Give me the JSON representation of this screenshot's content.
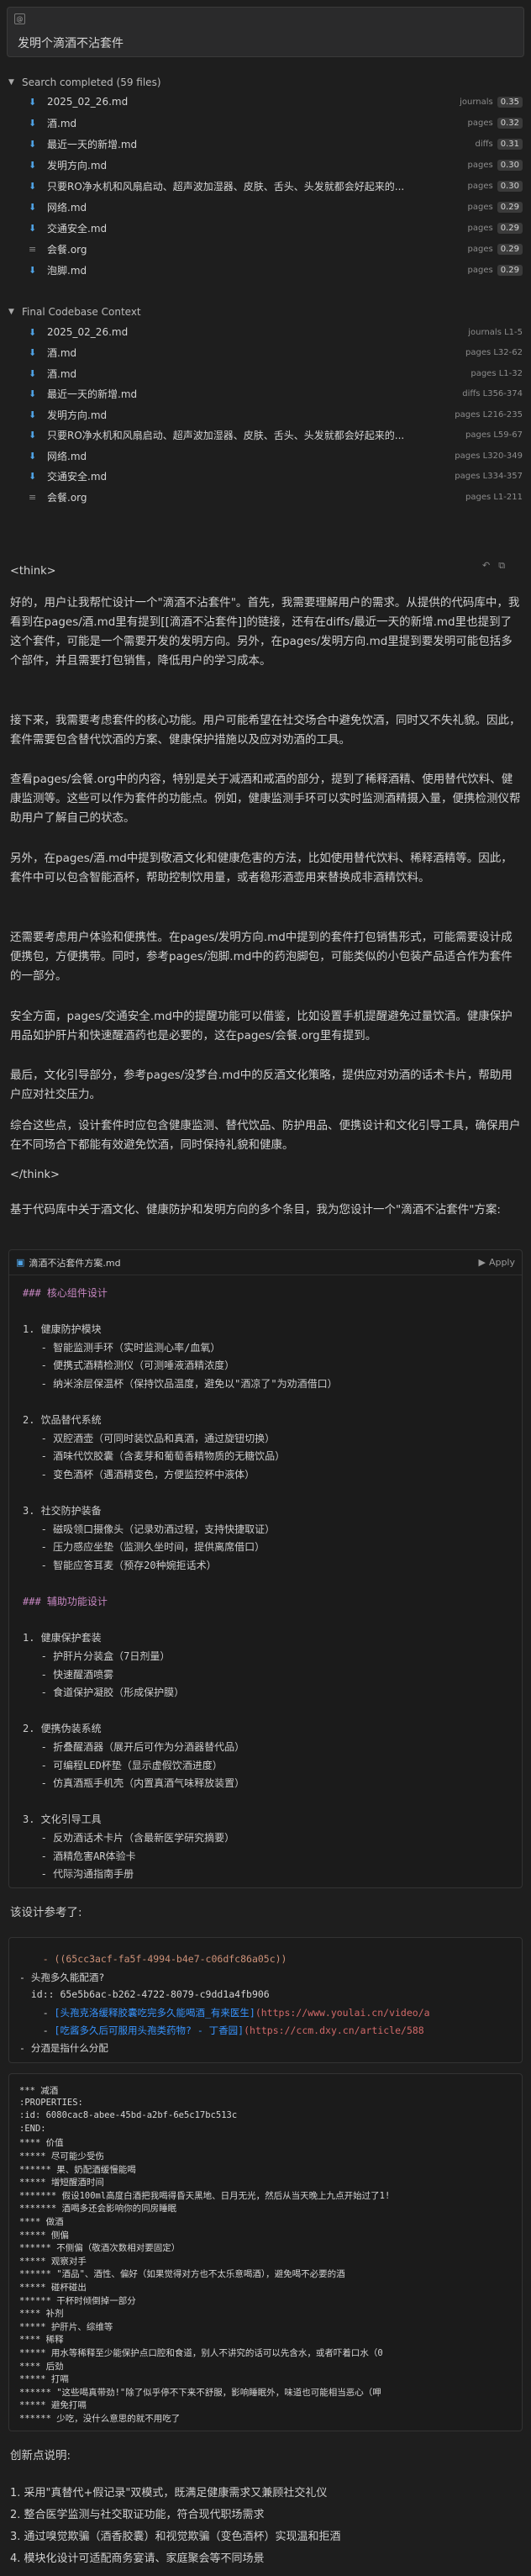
{
  "prompt": {
    "tag_icon": "at-icon",
    "text": "发明个滴酒不沾套件"
  },
  "search": {
    "header": "Search completed (59 files)",
    "rows": [
      {
        "name": "2025_02_26.md",
        "path": "journals",
        "score": "0.35",
        "icon": "download-icon"
      },
      {
        "name": "酒.md",
        "path": "pages",
        "score": "0.32",
        "icon": "download-icon"
      },
      {
        "name": "最近一天的新增.md",
        "path": "diffs",
        "score": "0.31",
        "icon": "download-icon"
      },
      {
        "name": "发明方向.md",
        "path": "pages",
        "score": "0.30",
        "icon": "download-icon"
      },
      {
        "name": "只要RO净水机和风扇启动、超声波加湿器、皮肤、舌头、头发就都会好起来的...",
        "path": "pages",
        "score": "0.30",
        "icon": "download-icon"
      },
      {
        "name": "网络.md",
        "path": "pages",
        "score": "0.29",
        "icon": "download-icon"
      },
      {
        "name": "交通安全.md",
        "path": "pages",
        "score": "0.29",
        "icon": "download-icon"
      },
      {
        "name": "会餐.org",
        "path": "pages",
        "score": "0.29",
        "icon": "org-icon"
      },
      {
        "name": "泡脚.md",
        "path": "pages",
        "score": "0.29",
        "icon": "download-icon"
      }
    ]
  },
  "context": {
    "header": "Final Codebase Context",
    "rows": [
      {
        "name": "2025_02_26.md",
        "path": "journals L1-5",
        "icon": "download-icon"
      },
      {
        "name": "酒.md",
        "path": "pages L32-62",
        "icon": "download-icon"
      },
      {
        "name": "酒.md",
        "path": "pages L1-32",
        "icon": "download-icon"
      },
      {
        "name": "最近一天的新增.md",
        "path": "diffs L356-374",
        "icon": "download-icon"
      },
      {
        "name": "发明方向.md",
        "path": "pages L216-235",
        "icon": "download-icon"
      },
      {
        "name": "只要RO净水机和风扇启动、超声波加湿器、皮肤、舌头、头发就都会好起来的...",
        "path": "pages L59-67",
        "icon": "download-icon"
      },
      {
        "name": "网络.md",
        "path": "pages L320-349",
        "icon": "download-icon"
      },
      {
        "name": "交通安全.md",
        "path": "pages L334-357",
        "icon": "download-icon"
      },
      {
        "name": "会餐.org",
        "path": "pages L1-211",
        "icon": "org-icon"
      }
    ]
  },
  "think_open": "<think>",
  "think_close": "</think>",
  "think_paragraphs": [
    "好的，用户让我帮忙设计一个\"滴酒不沾套件\"。首先，我需要理解用户的需求。从提供的代码库中，我看到在pages/酒.md里有提到[[滴酒不沾套件]]的链接，还有在diffs/最近一天的新增.md里也提到了这个套件，可能是一个需要开发的发明方向。另外，在pages/发明方向.md里提到要发明可能包括多个部件，并且需要打包销售，降低用户的学习成本。",
    "接下来，我需要考虑套件的核心功能。用户可能希望在社交场合中避免饮酒，同时又不失礼貌。因此，套件需要包含替代饮酒的方案、健康保护措施以及应对劝酒的工具。",
    "查看pages/会餐.org中的内容，特别是关于减酒和戒酒的部分，提到了稀释酒精、使用替代饮料、健康监测等。这些可以作为套件的功能点。例如，健康监测手环可以实时监测酒精摄入量，便携检测仪帮助用户了解自己的状态。",
    "另外，在pages/酒.md中提到敬酒文化和健康危害的方法，比如使用替代饮料、稀释酒精等。因此，套件中可以包含智能酒杯，帮助控制饮用量，或者稳形酒壶用来替换成非酒精饮料。",
    "还需要考虑用户体验和便携性。在pages/发明方向.md中提到的套件打包销售形式，可能需要设计成便携包，方便携带。同时，参考pages/泡脚.md中的药泡脚包，可能类似的小包装产品适合作为套件的一部分。",
    "安全方面，pages/交通安全.md中的提醒功能可以借鉴，比如设置手机提醒避免过量饮酒。健康保护用品如护肝片和快速醒酒药也是必要的，这在pages/会餐.org里有提到。",
    "最后，文化引导部分，参考pages/没梦台.md中的反酒文化策略，提供应对劝酒的话术卡片，帮助用户应对社交压力。",
    "综合这些点，设计套件时应包含健康监测、替代饮品、防护用品、便携设计和文化引导工具，确保用户在不同场合下都能有效避免饮酒，同时保持礼貌和健康。"
  ],
  "summary": "基于代码库中关于酒文化、健康防护和发明方向的多个条目，我为您设计一个\"滴酒不沾套件\"方案:",
  "code_card": {
    "file_name": "滴酒不沾套件方案.md",
    "apply_label": "Apply",
    "lines": [
      {
        "text": "### 核心组件设计",
        "kind": "head"
      },
      {
        "text": "",
        "kind": "plain"
      },
      {
        "text": "1. 健康防护模块",
        "kind": "plain"
      },
      {
        "text": "   - 智能监测手环（实时监测心率/血氧）",
        "kind": "plain"
      },
      {
        "text": "   - 便携式酒精检测仪（可测唾液酒精浓度）",
        "kind": "plain"
      },
      {
        "text": "   - 纳米涂层保温杯（保持饮品温度，避免以\"酒凉了\"为劝酒借口）",
        "kind": "plain"
      },
      {
        "text": "",
        "kind": "plain"
      },
      {
        "text": "2. 饮品替代系统",
        "kind": "plain"
      },
      {
        "text": "   - 双腔酒壶（可同时装饮品和真酒，通过旋钮切换）",
        "kind": "plain"
      },
      {
        "text": "   - 酒味代饮胶囊（含麦芽和葡萄香精物质的无糖饮品）",
        "kind": "plain"
      },
      {
        "text": "   - 变色酒杯（遇酒精变色，方便监控杯中液体）",
        "kind": "plain"
      },
      {
        "text": "",
        "kind": "plain"
      },
      {
        "text": "3. 社交防护装备",
        "kind": "plain"
      },
      {
        "text": "   - 磁吸领口摄像头（记录劝酒过程，支持快捷取证）",
        "kind": "plain"
      },
      {
        "text": "   - 压力感应坐垫（监测久坐时间，提供离席借口）",
        "kind": "plain"
      },
      {
        "text": "   - 智能应答耳麦（预存20种婉拒话术）",
        "kind": "plain"
      },
      {
        "text": "",
        "kind": "plain"
      },
      {
        "text": "### 辅助功能设计",
        "kind": "head"
      },
      {
        "text": "",
        "kind": "plain"
      },
      {
        "text": "1. 健康保护套装",
        "kind": "plain"
      },
      {
        "text": "   - 护肝片分装盒（7日剂量）",
        "kind": "plain"
      },
      {
        "text": "   - 快速醒酒喷雾",
        "kind": "plain"
      },
      {
        "text": "   - 食道保护凝胶（形成保护膜）",
        "kind": "plain"
      },
      {
        "text": "",
        "kind": "plain"
      },
      {
        "text": "2. 便携伪装系统",
        "kind": "plain"
      },
      {
        "text": "   - 折叠醒酒器（展开后可作为分酒器替代品）",
        "kind": "plain"
      },
      {
        "text": "   - 可编程LED杯垫（显示虚假饮酒进度）",
        "kind": "plain"
      },
      {
        "text": "   - 仿真酒瓶手机壳（内置真酒气味释放装置）",
        "kind": "plain"
      },
      {
        "text": "",
        "kind": "plain"
      },
      {
        "text": "3. 文化引导工具",
        "kind": "plain"
      },
      {
        "text": "   - 反劝酒话术卡片（含最新医学研究摘要）",
        "kind": "plain"
      },
      {
        "text": "   - 酒精危害AR体验卡",
        "kind": "plain"
      },
      {
        "text": "   - 代际沟通指南手册",
        "kind": "plain"
      }
    ]
  },
  "ref_intro": "该设计参考了:",
  "ref_card": {
    "lines": [
      {
        "segments": [
          {
            "t": "    - ((65cc3acf-fa5f-4994-b4e7-c06dfc86a05c))",
            "c": "uuid"
          }
        ]
      },
      {
        "segments": [
          {
            "t": "- 头孢多久能配酒?",
            "c": "plain"
          }
        ]
      },
      {
        "segments": [
          {
            "t": "  id:: 65e5b6ac-b262-4722-8079-c9dd1a4fb906",
            "c": "plain"
          }
        ]
      },
      {
        "segments": [
          {
            "t": "    - ",
            "c": "plain"
          },
          {
            "t": "[头孢克洛缓释胶囊吃完多久能喝酒_有来医生]",
            "c": "link"
          },
          {
            "t": "(https://www.youlai.cn/video/a",
            "c": "strikepink"
          }
        ]
      },
      {
        "segments": [
          {
            "t": "    - ",
            "c": "plain"
          },
          {
            "t": "[吃酱多久后可服用头孢类药物? - 丁香园]",
            "c": "link"
          },
          {
            "t": "(https://ccm.dxy.cn/article/588",
            "c": "strikepink"
          }
        ]
      },
      {
        "segments": [
          {
            "t": "- 分酒是指什么分配",
            "c": "plain"
          }
        ]
      }
    ]
  },
  "org_card": {
    "lines": [
      "*** 减酒",
      ":PROPERTIES:",
      ":id: 6080cac8-abee-45bd-a2bf-6e5c17bc513c",
      ":END:",
      "**** 价值",
      "***** 尽可能少受伤",
      "****** 果、奶配酒缓慢能喝",
      "***** 增短醒酒时间",
      "******* 假设100ml高度白酒把我喝得昏天黑地、日月无光，然后从当天晚上九点开始过了1!",
      "******* 酒喝多还会影响你的同房睡眠",
      "**** 做酒",
      "***** 侧偏",
      "****** 不侧偏（敬酒次数相对要固定）",
      "***** 观察对手",
      "****** \"酒品\"、酒性、偏好（如果觉得对方也不太乐意喝酒），避免喝不必要的酒",
      "***** 碰杯碰出",
      "****** 干杯时倾倒掉一部分",
      "**** 补剂",
      "***** 护肝片、综维等",
      "**** 稀释",
      "***** 用水等稀释至少能保护点口腔和食道，别人不讲究的话可以先含水，或者吓着口水（0",
      "**** 后劲",
      "***** 打嗝",
      "****** \"这些喝真带劲!\"除了似乎停不下来不舒服，影响睡眠外，味道也可能相当恶心（呷",
      "***** 避免打嗝",
      "****** 少吃，没什么意思的就不用吃了"
    ]
  },
  "innovation_title": "创新点说明:",
  "innovations": [
    "1. 采用\"真替代+假记录\"双模式，既满足健康需求又兼顾社交礼仪",
    "2. 整合医学监测与社交取证功能，符合现代职场需求",
    "3. 通过嗅觉欺骗（酒香胶囊）和视觉欺骗（变色酒杯）实现温和拒酒",
    "4. 模块化设计可适配商务宴请、家庭聚会等不同场景"
  ]
}
